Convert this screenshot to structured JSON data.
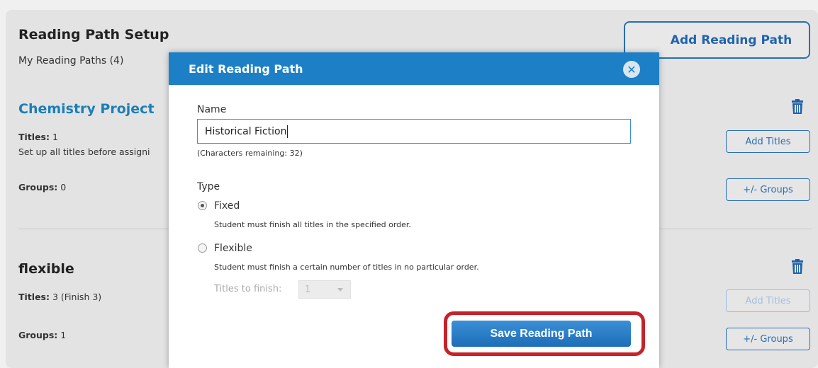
{
  "page": {
    "setup_title": "Reading Path Setup",
    "my_paths": "My Reading Paths (4)",
    "add_path_label": "Add Reading Path"
  },
  "cards": [
    {
      "title": "Chemistry Project",
      "titles_label": "Titles:",
      "titles_value": " 1",
      "note": "Set up all titles before assigni",
      "groups_label": "Groups:",
      "groups_value": " 0",
      "add_titles_label": "Add Titles",
      "groups_button_label": "+/- Groups"
    },
    {
      "title": "flexible",
      "titles_label": "Titles:",
      "titles_value": " 3 (Finish 3)",
      "groups_label": "Groups:",
      "groups_value": " 1",
      "add_titles_label": "Add Titles",
      "groups_button_label": "+/- Groups"
    }
  ],
  "modal": {
    "title": "Edit Reading Path",
    "close_icon": "close-icon",
    "name_label": "Name",
    "name_value": "Historical Fiction",
    "chars_remaining": "(Characters remaining: 32)",
    "type_label": "Type",
    "options": [
      {
        "label": "Fixed",
        "description": "Student must finish all titles in the specified order.",
        "checked": true
      },
      {
        "label": "Flexible",
        "description": "Student must finish a certain number of titles in no particular order.",
        "checked": false
      }
    ],
    "titles_to_finish_label": "Titles to finish:",
    "titles_to_finish_value": "1",
    "save_label": "Save Reading Path"
  },
  "colors": {
    "accent": "#1d80c6",
    "link": "#1a7fb8",
    "highlight": "#c4232b"
  }
}
